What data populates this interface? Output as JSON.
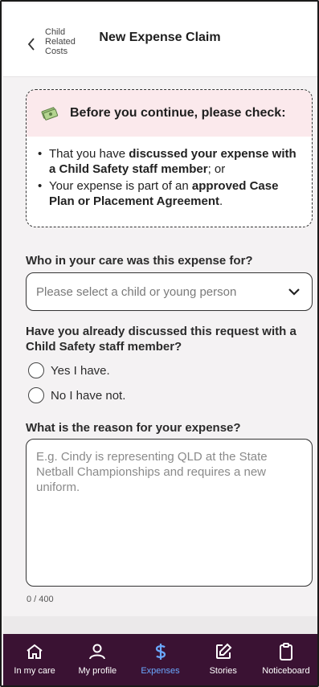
{
  "header": {
    "back_label": "Child\nRelated\nCosts",
    "title": "New Expense Claim"
  },
  "info_card": {
    "icon": "money-icon",
    "heading": "Before you continue, please check:",
    "item1_pre": "That you have ",
    "item1_bold": "discussed your expense with a Child Safety staff member",
    "item1_post": "; or",
    "item2_pre": "Your expense is part of an ",
    "item2_bold": "approved Case Plan or Placement Agreement",
    "item2_post": "."
  },
  "form": {
    "child_question": "Who in your care was this expense for?",
    "child_select_placeholder": "Please select a child or young person",
    "discussed_question": "Have you already discussed this request with a Child Safety staff member?",
    "radio_yes": "Yes I have.",
    "radio_no": "No I have not.",
    "reason_question": "What is the reason for your expense?",
    "reason_placeholder": "E.g. Cindy is representing QLD at the State Netball Championships and requires a new uniform.",
    "char_counter": "0 / 400"
  },
  "bottom_nav": {
    "items": [
      {
        "label": "In my care",
        "icon": "home-icon"
      },
      {
        "label": "My profile",
        "icon": "person-icon"
      },
      {
        "label": "Expenses",
        "icon": "dollar-icon"
      },
      {
        "label": "Stories",
        "icon": "edit-icon"
      },
      {
        "label": "Noticeboard",
        "icon": "clipboard-icon"
      }
    ],
    "active": "Expenses"
  },
  "colors": {
    "nav_background": "#3a1233",
    "active_nav": "#6aa8ff",
    "info_head_bg": "#fbe9ec"
  }
}
